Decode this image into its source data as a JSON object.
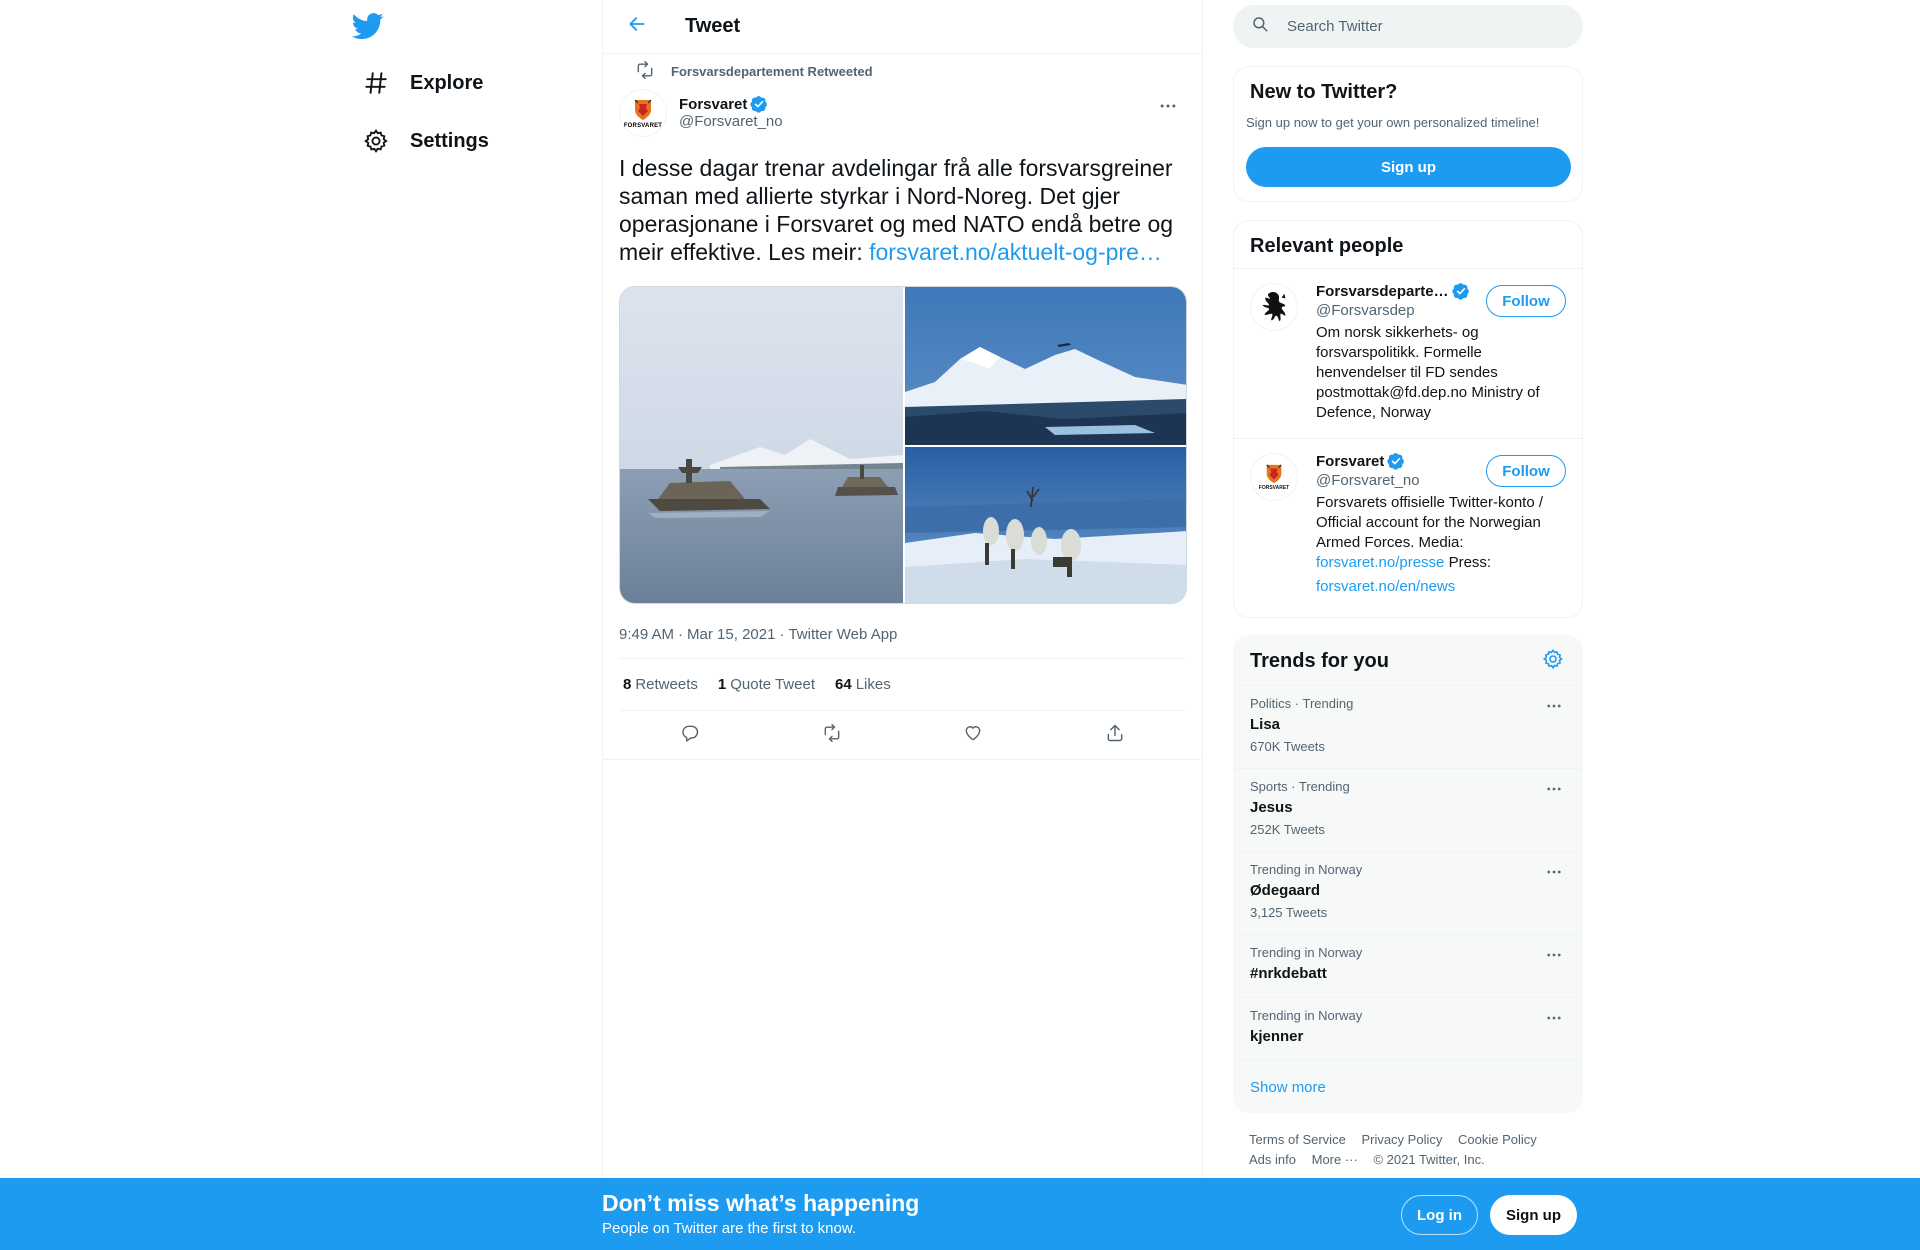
{
  "nav": {
    "logo_icon": "twitter-bird-icon",
    "items": [
      {
        "label": "Explore",
        "icon": "hashtag-icon"
      },
      {
        "label": "Settings",
        "icon": "gear-icon"
      }
    ]
  },
  "header": {
    "title": "Tweet",
    "back_icon": "arrow-left-icon"
  },
  "tweet": {
    "retweeted_by": "Forsvarsdepartement Retweeted",
    "author": {
      "name": "Forsvaret",
      "handle": "@Forsvaret_no",
      "avatar_text": "FORSVARET",
      "verified": true
    },
    "text": "I desse dagar trenar avdelingar frå alle forsvarsgreiner saman med allierte styrkar i Nord-Noreg. Det gjer operasjonane i Forsvaret og med NATO endå betre og meir effektive. Les meir: ",
    "link": "forsvaret.no/aktuelt-og-pre…",
    "time": "9:49 AM",
    "date": "Mar 15, 2021",
    "source": "Twitter Web App",
    "separator": "·",
    "stats": {
      "retweets_count": "8",
      "retweets_label": "Retweets",
      "quotes_count": "1",
      "quotes_label": "Quote Tweet",
      "likes_count": "64",
      "likes_label": "Likes"
    },
    "media": [
      "photo-warships",
      "photo-mountains-aircraft",
      "photo-soldiers-snow"
    ]
  },
  "sidebar": {
    "search": {
      "placeholder": "Search Twitter"
    },
    "new_to_twitter": {
      "title": "New to Twitter?",
      "subtitle": "Sign up now to get your own personalized timeline!",
      "button": "Sign up"
    },
    "relevant_people": {
      "title": "Relevant people",
      "people": [
        {
          "name": "Forsvarsdeparte…",
          "handle": "@Forsvarsdep",
          "bio": "Om norsk sikkerhets- og forsvarspolitikk. Formelle henvendelser til FD sendes postmottak@fd.dep.no Ministry of Defence, Norway",
          "button": "Follow"
        },
        {
          "name": "Forsvaret",
          "handle": "@Forsvaret_no",
          "bio_prefix": "Forsvarets offisielle Twitter-konto / Official account for the Norwegian Armed Forces. Media: ",
          "bio_link1": "forsvaret.no/presse",
          "bio_middle": " Press: ",
          "bio_link2": "forsvaret.no/en/news",
          "avatar_text": "FORSVARET",
          "button": "Follow"
        }
      ]
    },
    "trends": {
      "title": "Trends for you",
      "items": [
        {
          "context": "Politics · Trending",
          "name": "Lisa",
          "count": "670K Tweets"
        },
        {
          "context": "Sports · Trending",
          "name": "Jesus",
          "count": "252K Tweets"
        },
        {
          "context": "Trending in Norway",
          "name": "Ødegaard",
          "count": "3,125 Tweets"
        },
        {
          "context": "Trending in Norway",
          "name": "#nrkdebatt",
          "count": ""
        },
        {
          "context": "Trending in Norway",
          "name": "kjenner",
          "count": ""
        }
      ],
      "show_more": "Show more"
    },
    "footer": {
      "terms": "Terms of Service",
      "privacy": "Privacy Policy",
      "cookie": "Cookie Policy",
      "ads": "Ads info",
      "more": "More ···",
      "copyright": "© 2021 Twitter, Inc."
    }
  },
  "banner": {
    "title": "Don’t miss what’s happening",
    "subtitle": "People on Twitter are the first to know.",
    "login": "Log in",
    "signup": "Sign up"
  },
  "colors": {
    "accent": "#1d9bf0",
    "text": "#0f1419",
    "muted": "#536471"
  }
}
